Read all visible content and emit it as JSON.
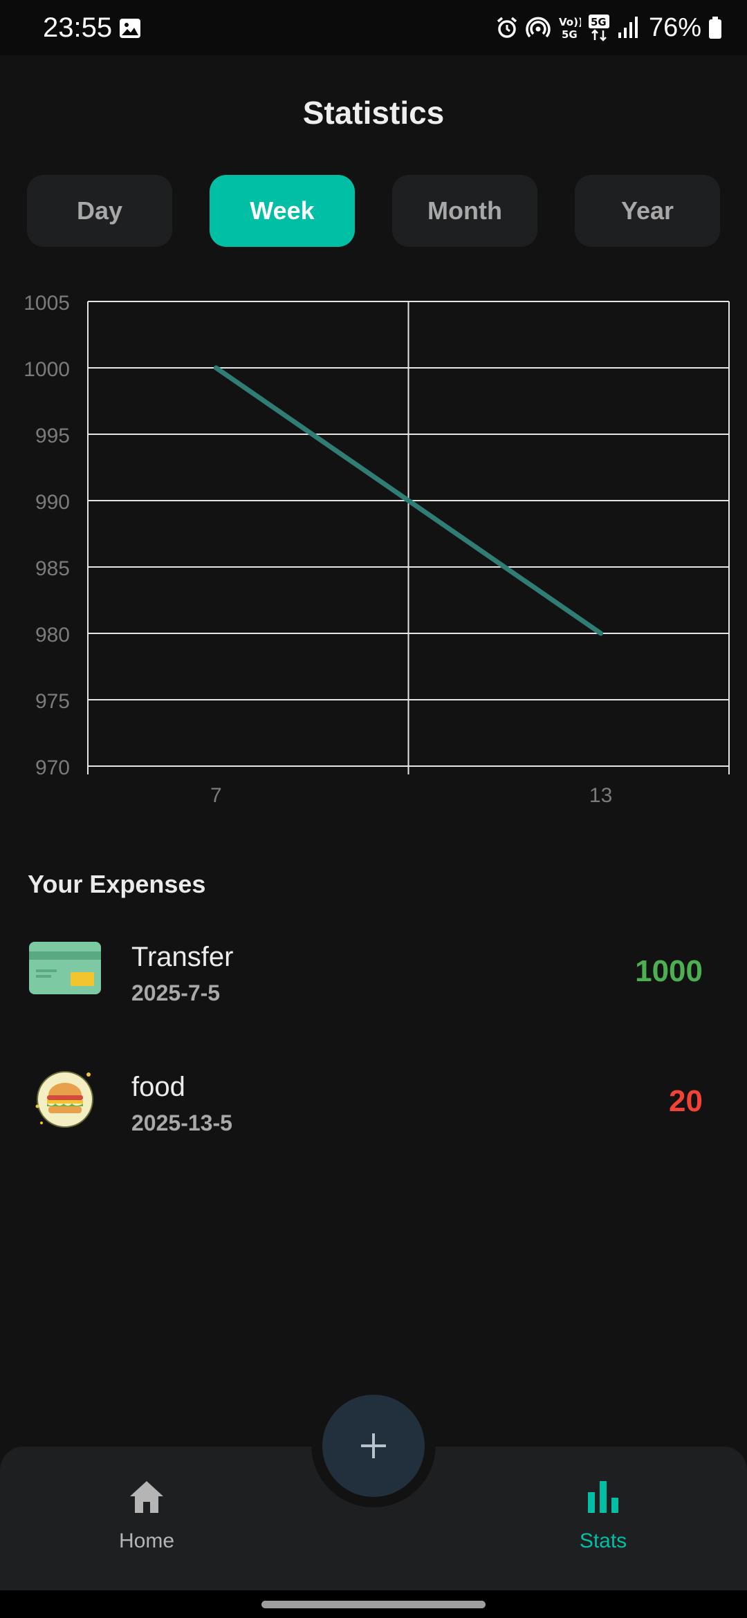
{
  "status_bar": {
    "time": "23:55",
    "battery": "76%",
    "icons": [
      "image-icon",
      "alarm-icon",
      "hotspot-icon",
      "volte-icon",
      "5g-icon",
      "signal-icon",
      "battery-icon"
    ]
  },
  "header": {
    "title": "Statistics"
  },
  "tabs": [
    {
      "label": "Day",
      "active": false
    },
    {
      "label": "Week",
      "active": true
    },
    {
      "label": "Month",
      "active": false
    },
    {
      "label": "Year",
      "active": false
    }
  ],
  "chart_data": {
    "type": "line",
    "x_tick_labels": [
      "7",
      "13"
    ],
    "y_tick_labels": [
      "1005",
      "1000",
      "995",
      "990",
      "985",
      "980",
      "975",
      "970"
    ],
    "ylim": [
      970,
      1005
    ],
    "xlim": [
      5,
      15
    ],
    "grid": true,
    "series": [
      {
        "x": [
          7,
          13
        ],
        "y": [
          1000,
          980
        ],
        "color": "#2f7d75"
      }
    ]
  },
  "expenses": {
    "title": "Your Expenses",
    "items": [
      {
        "name": "Transfer",
        "date": "2025-7-5",
        "amount": "1000",
        "kind": "income",
        "icon": "credit-card-icon"
      },
      {
        "name": "food",
        "date": "2025-13-5",
        "amount": "20",
        "kind": "expense",
        "icon": "burger-icon"
      }
    ]
  },
  "bottom_nav": {
    "fab_icon": "plus-icon",
    "items": [
      {
        "label": "Home",
        "icon": "home-icon",
        "active": false
      },
      {
        "label": "Stats",
        "icon": "bar-chart-icon",
        "active": true
      }
    ]
  },
  "colors": {
    "accent": "#00bfa5",
    "income": "#4caf50",
    "expense": "#f44336",
    "line": "#2f7d75"
  }
}
